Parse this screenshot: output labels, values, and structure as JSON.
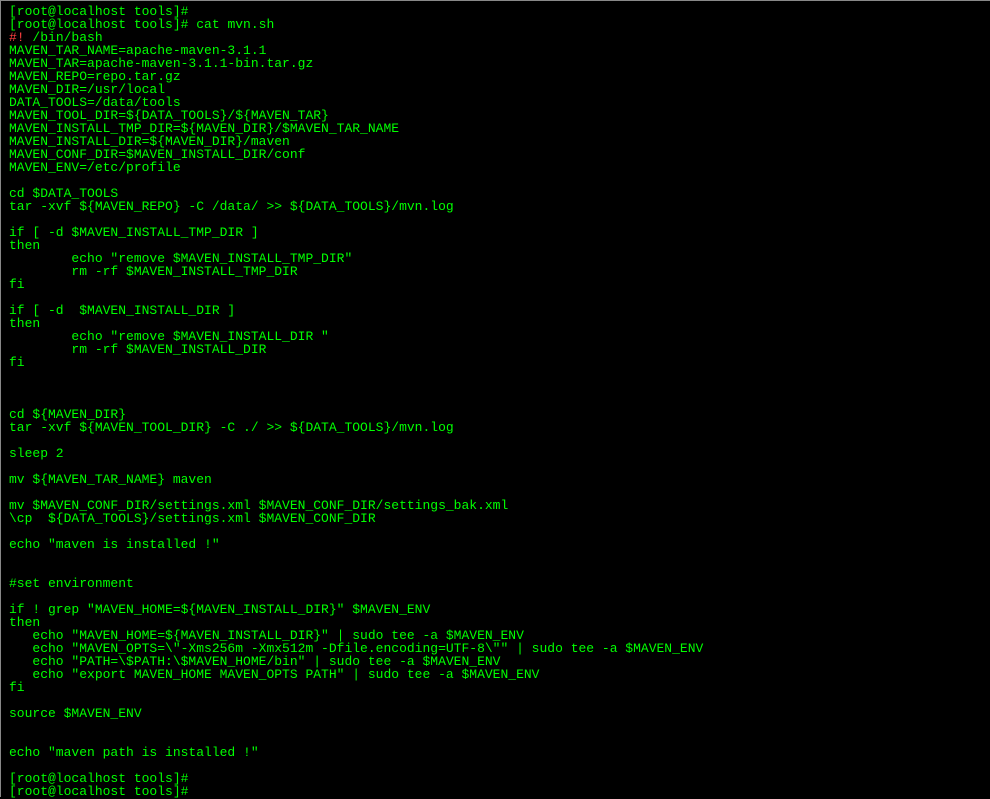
{
  "prompt": {
    "user_host": "[root@localhost tools]#",
    "command1": " cat mvn.sh"
  },
  "script": {
    "shebang": "#!",
    "shebang_path": " /bin/bash",
    "l01": "MAVEN_TAR_NAME=apache-maven-3.1.1",
    "l02": "MAVEN_TAR=apache-maven-3.1.1-bin.tar.gz",
    "l03": "MAVEN_REPO=repo.tar.gz",
    "l04": "MAVEN_DIR=/usr/local",
    "l05": "DATA_TOOLS=/data/tools",
    "l06": "MAVEN_TOOL_DIR=${DATA_TOOLS}/${MAVEN_TAR}",
    "l07": "MAVEN_INSTALL_TMP_DIR=${MAVEN_DIR}/$MAVEN_TAR_NAME",
    "l08": "MAVEN_INSTALL_DIR=${MAVEN_DIR}/maven",
    "l09": "MAVEN_CONF_DIR=$MAVEN_INSTALL_DIR/conf",
    "l10": "MAVEN_ENV=/etc/profile",
    "l11": "",
    "l12": "cd $DATA_TOOLS",
    "l13": "tar -xvf ${MAVEN_REPO} -C /data/ >> ${DATA_TOOLS}/mvn.log",
    "l14": "",
    "l15": "if [ -d $MAVEN_INSTALL_TMP_DIR ]",
    "l16": "then",
    "l17": "        echo \"remove $MAVEN_INSTALL_TMP_DIR\"",
    "l18": "        rm -rf $MAVEN_INSTALL_TMP_DIR",
    "l19": "fi",
    "l20": "",
    "l21": "if [ -d  $MAVEN_INSTALL_DIR ]",
    "l22": "then",
    "l23": "        echo \"remove $MAVEN_INSTALL_DIR \"",
    "l24": "        rm -rf $MAVEN_INSTALL_DIR",
    "l25": "fi",
    "l26": "",
    "l27": "",
    "l28": "",
    "l29": "cd ${MAVEN_DIR}",
    "l30": "tar -xvf ${MAVEN_TOOL_DIR} -C ./ >> ${DATA_TOOLS}/mvn.log",
    "l31": "",
    "l32": "sleep 2",
    "l33": "",
    "l34": "mv ${MAVEN_TAR_NAME} maven",
    "l35": "",
    "l36": "mv $MAVEN_CONF_DIR/settings.xml $MAVEN_CONF_DIR/settings_bak.xml",
    "l37": "\\cp  ${DATA_TOOLS}/settings.xml $MAVEN_CONF_DIR",
    "l38": "",
    "l39": "echo \"maven is installed !\"",
    "l40": "",
    "l41": "",
    "l42": "#set environment",
    "l43": "",
    "l44": "if ! grep \"MAVEN_HOME=${MAVEN_INSTALL_DIR}\" $MAVEN_ENV",
    "l45": "then",
    "l46": "   echo \"MAVEN_HOME=${MAVEN_INSTALL_DIR}\" | sudo tee -a $MAVEN_ENV",
    "l47": "   echo \"MAVEN_OPTS=\\\"-Xms256m -Xmx512m -Dfile.encoding=UTF-8\\\"\" | sudo tee -a $MAVEN_ENV",
    "l48": "   echo \"PATH=\\$PATH:\\$MAVEN_HOME/bin\" | sudo tee -a $MAVEN_ENV",
    "l49": "   echo \"export MAVEN_HOME MAVEN_OPTS PATH\" | sudo tee -a $MAVEN_ENV",
    "l50": "fi",
    "l51": "",
    "l52": "source $MAVEN_ENV",
    "l53": "",
    "l54": "",
    "l55": "echo \"maven path is installed !\"",
    "l56": ""
  }
}
